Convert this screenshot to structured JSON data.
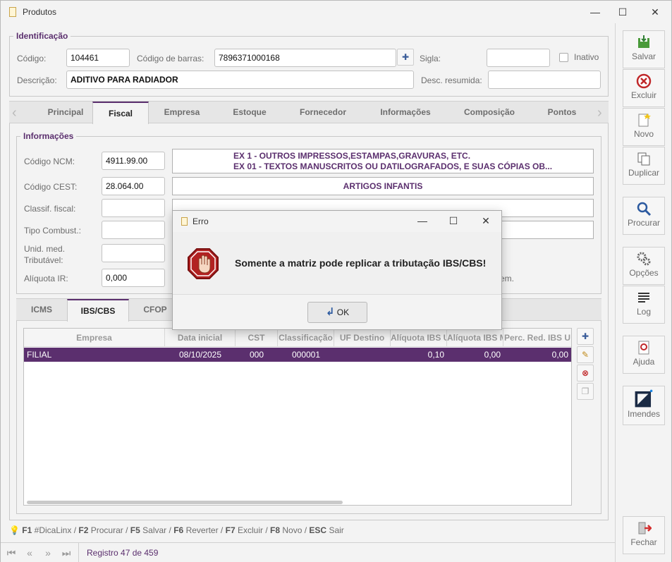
{
  "window": {
    "title": "Produtos",
    "minimize": "—",
    "maximize": "☐",
    "close": "✕"
  },
  "identificacao": {
    "legend": "Identificação",
    "codigo_label": "Código:",
    "codigo_value": "104461",
    "barras_label": "Código de barras:",
    "barras_value": "7896371000168",
    "sigla_label": "Sigla:",
    "sigla_value": "",
    "inativo_label": "Inativo",
    "descricao_label": "Descrição:",
    "descricao_value": "ADITIVO PARA RADIADOR",
    "desc_resumida_label": "Desc. resumida:",
    "desc_resumida_value": ""
  },
  "tabs": [
    "Principal",
    "Fiscal",
    "Empresa",
    "Estoque",
    "Fornecedor",
    "Informações",
    "Composição",
    "Pontos"
  ],
  "informacoes": {
    "legend": "Informações",
    "ncm_label": "Código NCM:",
    "ncm_value": "4911.99.00",
    "ncm_desc_1": "EX 1 - OUTROS IMPRESSOS,ESTAMPAS,GRAVURAS, ETC.",
    "ncm_desc_2": "EX 01 - TEXTOS MANUSCRITOS OU DATILOGRAFADOS, E SUAS CÓPIAS OB...",
    "cest_label": "Código CEST:",
    "cest_value": "28.064.00",
    "cest_desc": "ARTIGOS INFANTIS",
    "classif_label": "Classif. fiscal:",
    "combust_label": "Tipo Combust.:",
    "unid_label_1": "Unid. med.",
    "unid_label_2": "Tributável:",
    "aliq_ir_label": "Alíquota IR:",
    "aliq_ir_value": "0,000",
    "trailing_text": "em."
  },
  "subtabs": [
    "ICMS",
    "IBS/CBS",
    "CFOP"
  ],
  "grid": {
    "columns": [
      "Empresa",
      "Data inicial",
      "CST",
      "Classificação",
      "UF Destino",
      "Alíquota IBS U",
      "Alíquota IBS M",
      "Perc. Red. IBS U"
    ],
    "rows": [
      {
        "empresa": "FILIAL",
        "data": "08/10/2025",
        "cst": "000",
        "classificacao": "000001",
        "uf": "",
        "aliq_u": "0,10",
        "aliq_m": "0,00",
        "perc_u": "0,00"
      }
    ]
  },
  "sidebar": [
    {
      "name": "salvar",
      "label": "Salvar"
    },
    {
      "name": "excluir",
      "label": "Excluir"
    },
    {
      "name": "novo",
      "label": "Novo"
    },
    {
      "name": "duplicar",
      "label": "Duplicar"
    },
    {
      "name": "procurar",
      "label": "Procurar"
    },
    {
      "name": "opcoes",
      "label": "Opções"
    },
    {
      "name": "log",
      "label": "Log"
    },
    {
      "name": "ajuda",
      "label": "Ajuda"
    },
    {
      "name": "imendes",
      "label": "Imendes"
    },
    {
      "name": "fechar",
      "label": "Fechar"
    }
  ],
  "shortcuts": {
    "k1": "F1",
    "t1": "#DicaLinx",
    "k2": "F2",
    "t2": "Procurar",
    "k3": "F5",
    "t3": "Salvar",
    "k4": "F6",
    "t4": "Reverter",
    "k5": "F7",
    "t5": "Excluir",
    "k6": "F8",
    "t6": "Novo",
    "k7": "ESC",
    "t7": "Sair",
    "sep": "/"
  },
  "status": {
    "registro": "Registro 47 de 459"
  },
  "dialog": {
    "title": "Erro",
    "message": "Somente a matriz pode replicar a tributação IBS/CBS!",
    "ok": "OK"
  },
  "colors": {
    "accent": "#5b2f6e",
    "error": "#b22222"
  }
}
